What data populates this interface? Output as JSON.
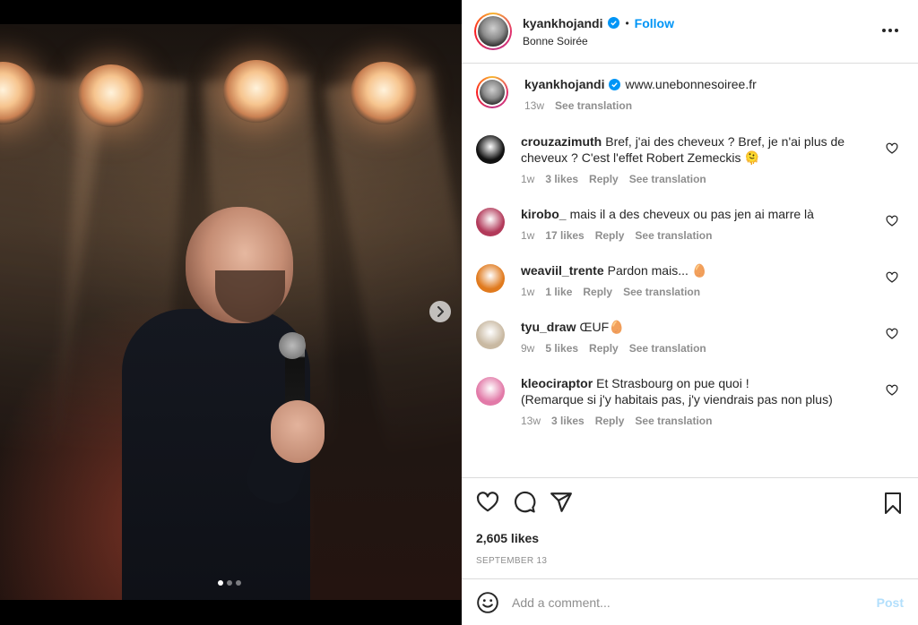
{
  "post": {
    "author": "kyankhojandi",
    "follow_label": "Follow",
    "separator": "•",
    "location": "Bonne Soirée",
    "caption": {
      "username": "kyankhojandi",
      "text": "www.unebonnesoiree.fr",
      "time": "13w",
      "see_translation": "See translation"
    },
    "carousel": {
      "current": 1,
      "total": 3
    }
  },
  "comments": [
    {
      "username": "crouzazimuth",
      "text": "Bref, j'ai des cheveux ? Bref, je n'ai plus de cheveux ? C'est l'effet Robert Zemeckis 🫠",
      "time": "1w",
      "likes": "3 likes",
      "reply": "Reply",
      "see_translation": "See translation",
      "avatar_color": "#111111"
    },
    {
      "username": "kirobo_",
      "text": "mais il a des cheveux ou pas jen ai marre là",
      "time": "1w",
      "likes": "17 likes",
      "reply": "Reply",
      "see_translation": "See translation",
      "avatar_color": "#b23a5a"
    },
    {
      "username": "weaviil_trente",
      "text": "Pardon mais... 🥚",
      "time": "1w",
      "likes": "1 like",
      "reply": "Reply",
      "see_translation": "See translation",
      "avatar_color": "#e07a1e"
    },
    {
      "username": "tyu_draw",
      "text": "ŒUF🥚",
      "time": "9w",
      "likes": "5 likes",
      "reply": "Reply",
      "see_translation": "See translation",
      "avatar_color": "#c9b9a2"
    },
    {
      "username": "kleociraptor",
      "text": "Et Strasbourg on pue quoi !\n(Remarque si j'y habitais pas, j'y viendrais pas non plus)",
      "time": "13w",
      "likes": "3 likes",
      "reply": "Reply",
      "see_translation": "See translation",
      "avatar_color": "#e27aa8"
    }
  ],
  "stats": {
    "likes": "2,605 likes",
    "date": "SEPTEMBER 13"
  },
  "composer": {
    "placeholder": "Add a comment...",
    "post_label": "Post"
  },
  "colors": {
    "accent": "#0095f6",
    "post_disabled": "#b2dffc",
    "muted": "#8e8e8e"
  }
}
